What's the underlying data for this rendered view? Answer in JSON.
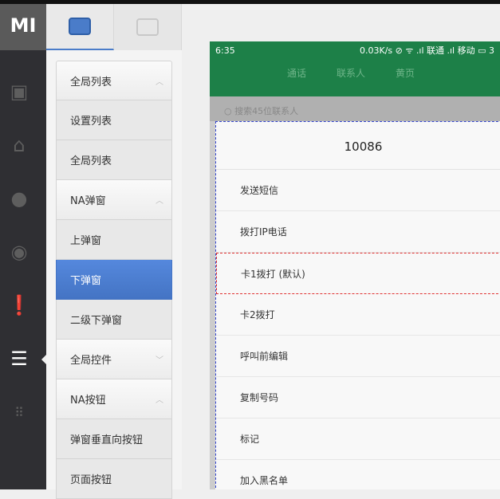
{
  "logo": "MI",
  "rail": [
    "ide-icon",
    "home-icon",
    "user-icon",
    "chat-icon",
    "alert-icon",
    "menu-icon",
    "grid-icon"
  ],
  "menu": [
    {
      "label": "全局列表",
      "type": "group",
      "chevron": "up"
    },
    {
      "label": "设置列表",
      "type": "item"
    },
    {
      "label": "全局列表",
      "type": "item"
    },
    {
      "label": "NA弹窗",
      "type": "group",
      "chevron": "up"
    },
    {
      "label": "上弹窗",
      "type": "item"
    },
    {
      "label": "下弹窗",
      "type": "item",
      "selected": true
    },
    {
      "label": "二级下弹窗",
      "type": "item"
    },
    {
      "label": "全局控件",
      "type": "group",
      "chevron": "down"
    },
    {
      "label": "NA按钮",
      "type": "group",
      "chevron": "up"
    },
    {
      "label": "弹窗垂直向按钮",
      "type": "item"
    },
    {
      "label": "页面按钮",
      "type": "item"
    }
  ],
  "phone": {
    "time": "6:35",
    "status_right": "0.03K/s ⊘ ᯤ .ıl 联通 .ıl 移动 ▭ 3",
    "tabs": [
      "通话",
      "联系人",
      "黄页"
    ],
    "search_placeholder": "搜索45位联系人",
    "dialog_title": "10086",
    "options": [
      "发送短信",
      "拨打IP电话",
      "卡1拨打 (默认)",
      "卡2拨打",
      "呼叫前编辑",
      "复制号码",
      "标记",
      "加入黑名单"
    ]
  },
  "colors": {
    "accent": "#4a7cc9",
    "green": "#1d8048"
  }
}
